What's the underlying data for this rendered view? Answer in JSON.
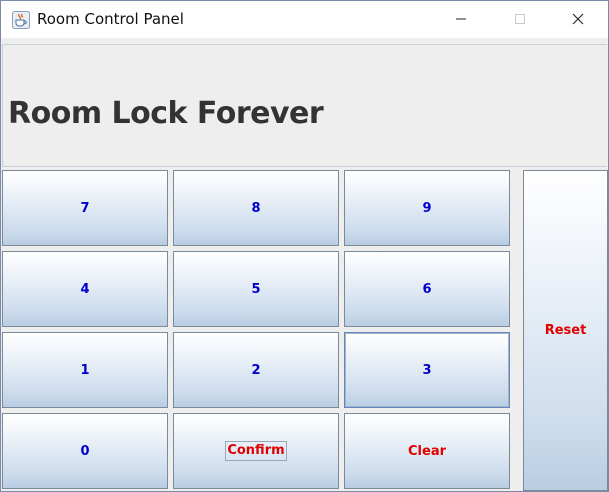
{
  "window": {
    "title": "Room Control Panel",
    "icon": "java-cup-icon",
    "controls": [
      "minimize-icon",
      "maximize-icon",
      "close-icon"
    ]
  },
  "status": {
    "text": "Room Lock Forever"
  },
  "keypad": {
    "keys": [
      {
        "label": "7",
        "color": "#0000cc"
      },
      {
        "label": "8",
        "color": "#0000cc"
      },
      {
        "label": "9",
        "color": "#0000cc"
      },
      {
        "label": "4",
        "color": "#0000cc"
      },
      {
        "label": "5",
        "color": "#0000cc"
      },
      {
        "label": "6",
        "color": "#0000cc"
      },
      {
        "label": "1",
        "color": "#0000cc"
      },
      {
        "label": "2",
        "color": "#0000cc"
      },
      {
        "label": "3",
        "color": "#0000cc"
      },
      {
        "label": "0",
        "color": "#0000cc"
      },
      {
        "label": "Confirm",
        "color": "#e00000"
      },
      {
        "label": "Clear",
        "color": "#e00000"
      }
    ],
    "reset_label": "Reset"
  },
  "colors": {
    "digit_text": "#0000cc",
    "action_text": "#e00000",
    "panel_background": "#eeeeee"
  }
}
